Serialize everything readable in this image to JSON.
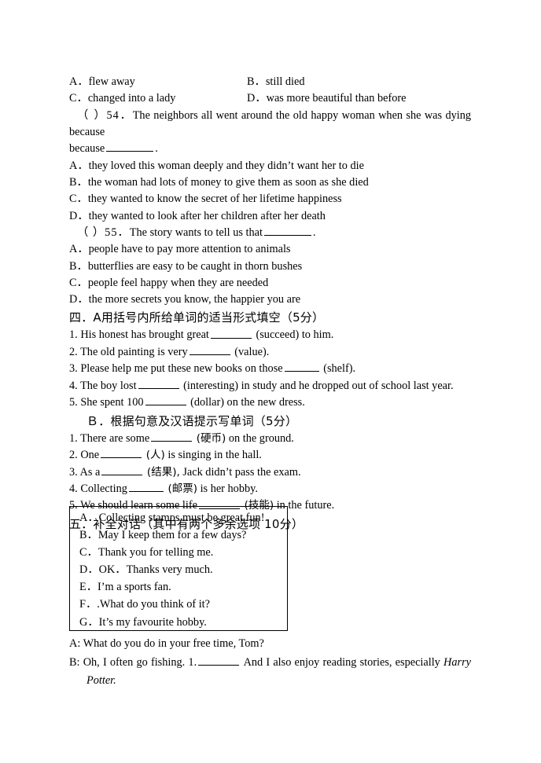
{
  "document": {
    "type": "english-exam-worksheet",
    "reading_options_prev": {
      "a_label": "A．flew away",
      "b_label": "B．still died",
      "c_label": "C．changed into a lady",
      "d_label": "D．was more beautiful than before"
    },
    "question_54": {
      "marker": "（    ）54．",
      "stem_part1": "The neighbors all went around the old happy woman when she was dying because",
      "stem_end": ".",
      "options": [
        "A．they loved this woman deeply and they didn’t want her to die",
        "B．the woman had lots of money to give them as soon as she died",
        "C．they wanted to know the secret of her lifetime happiness",
        "D．they wanted to look after her children after her death"
      ]
    },
    "question_55": {
      "marker": "（    ）55．",
      "stem_part1": "The story wants to tell us that",
      "stem_end": ".",
      "options": [
        "A．people have to pay more attention to animals",
        "B．butterflies are easy to be caught in thorn bushes",
        "C．people feel happy when they are needed",
        "D．the more secrets you know, the happier you are"
      ]
    },
    "section_four": {
      "heading": "四．A用括号内所给单词的适当形式填空（5分）",
      "items": [
        {
          "num": "1.",
          "before": "His honest has brought great",
          "after": "(succeed) to him."
        },
        {
          "num": "2.",
          "before": "The old painting is very",
          "after": "(value)."
        },
        {
          "num": "3.",
          "before": "Please help me put these new books on those",
          "after": "(shelf)."
        },
        {
          "num": "4.",
          "before": "The boy lost",
          "after": "(interesting) in study and he dropped out of school last year."
        },
        {
          "num": "5.",
          "before": "She spent 100",
          "after": "(dollar) on the new dress."
        }
      ],
      "sub_heading": "Ｂ．根据句意及汉语提示写单词（5分）",
      "sub_items": [
        {
          "num": "1.",
          "before": "There are some",
          "hint": "(硬币)",
          "after": "on the ground."
        },
        {
          "num": "2.",
          "before": "One",
          "hint": "(人)",
          "after": "is singing in the hall."
        },
        {
          "num": "3.",
          "before": "As a",
          "hint": "(结果),",
          "after": "Jack didn’t pass the exam."
        },
        {
          "num": "4.",
          "before": "Collecting",
          "hint": "(邮票)",
          "after": "is her hobby."
        },
        {
          "num": "5.",
          "before": "We should learn some life",
          "hint": "(技能)",
          "after": "in the future."
        }
      ]
    },
    "section_five": {
      "heading": "五．补全对话（其中有两个多余选项 10分）",
      "choice_box": [
        "A．Collecting stamps must be great fun!",
        "B．May I keep them for a few days?",
        "C．Thank you for telling me.",
        "D．OK．Thanks very much.",
        "E．I’m a sports fan.",
        "F．.What do you think of it?",
        "G．It’s my favourite hobby."
      ],
      "dialogue": {
        "line_a": "A: What do you do in your free time, Tom?",
        "line_b_before": "B: Oh, I often go fishing. 1.",
        "line_b_after": "And I also enjoy reading stories, especially",
        "line_b_italic": "Harry",
        "line_b_cont_italic": "Potter."
      }
    }
  }
}
